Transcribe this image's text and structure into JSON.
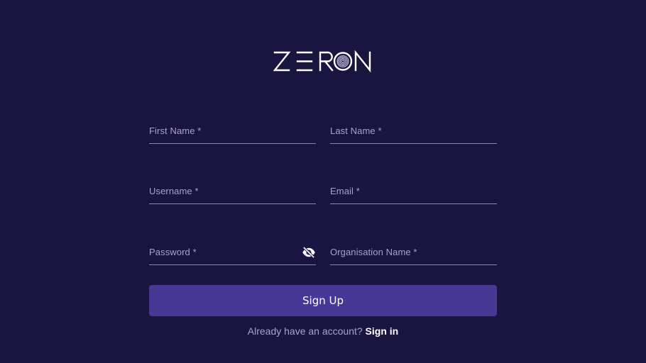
{
  "brand": {
    "logo_text": "ZERON"
  },
  "form": {
    "first_name_label": "First Name *",
    "last_name_label": "Last Name *",
    "username_label": "Username *",
    "email_label": "Email *",
    "password_label": "Password *",
    "organisation_label": "Organisation Name *",
    "password_toggle_icon": "eye-off-icon"
  },
  "actions": {
    "signup_label": "Sign Up",
    "signin_prompt": "Already have an account? ",
    "signin_link": "Sign in"
  },
  "colors": {
    "background": "#1a1540",
    "button": "#473896",
    "label": "#a7a3c9",
    "underline": "#8d89ad",
    "link": "#ffffff"
  }
}
